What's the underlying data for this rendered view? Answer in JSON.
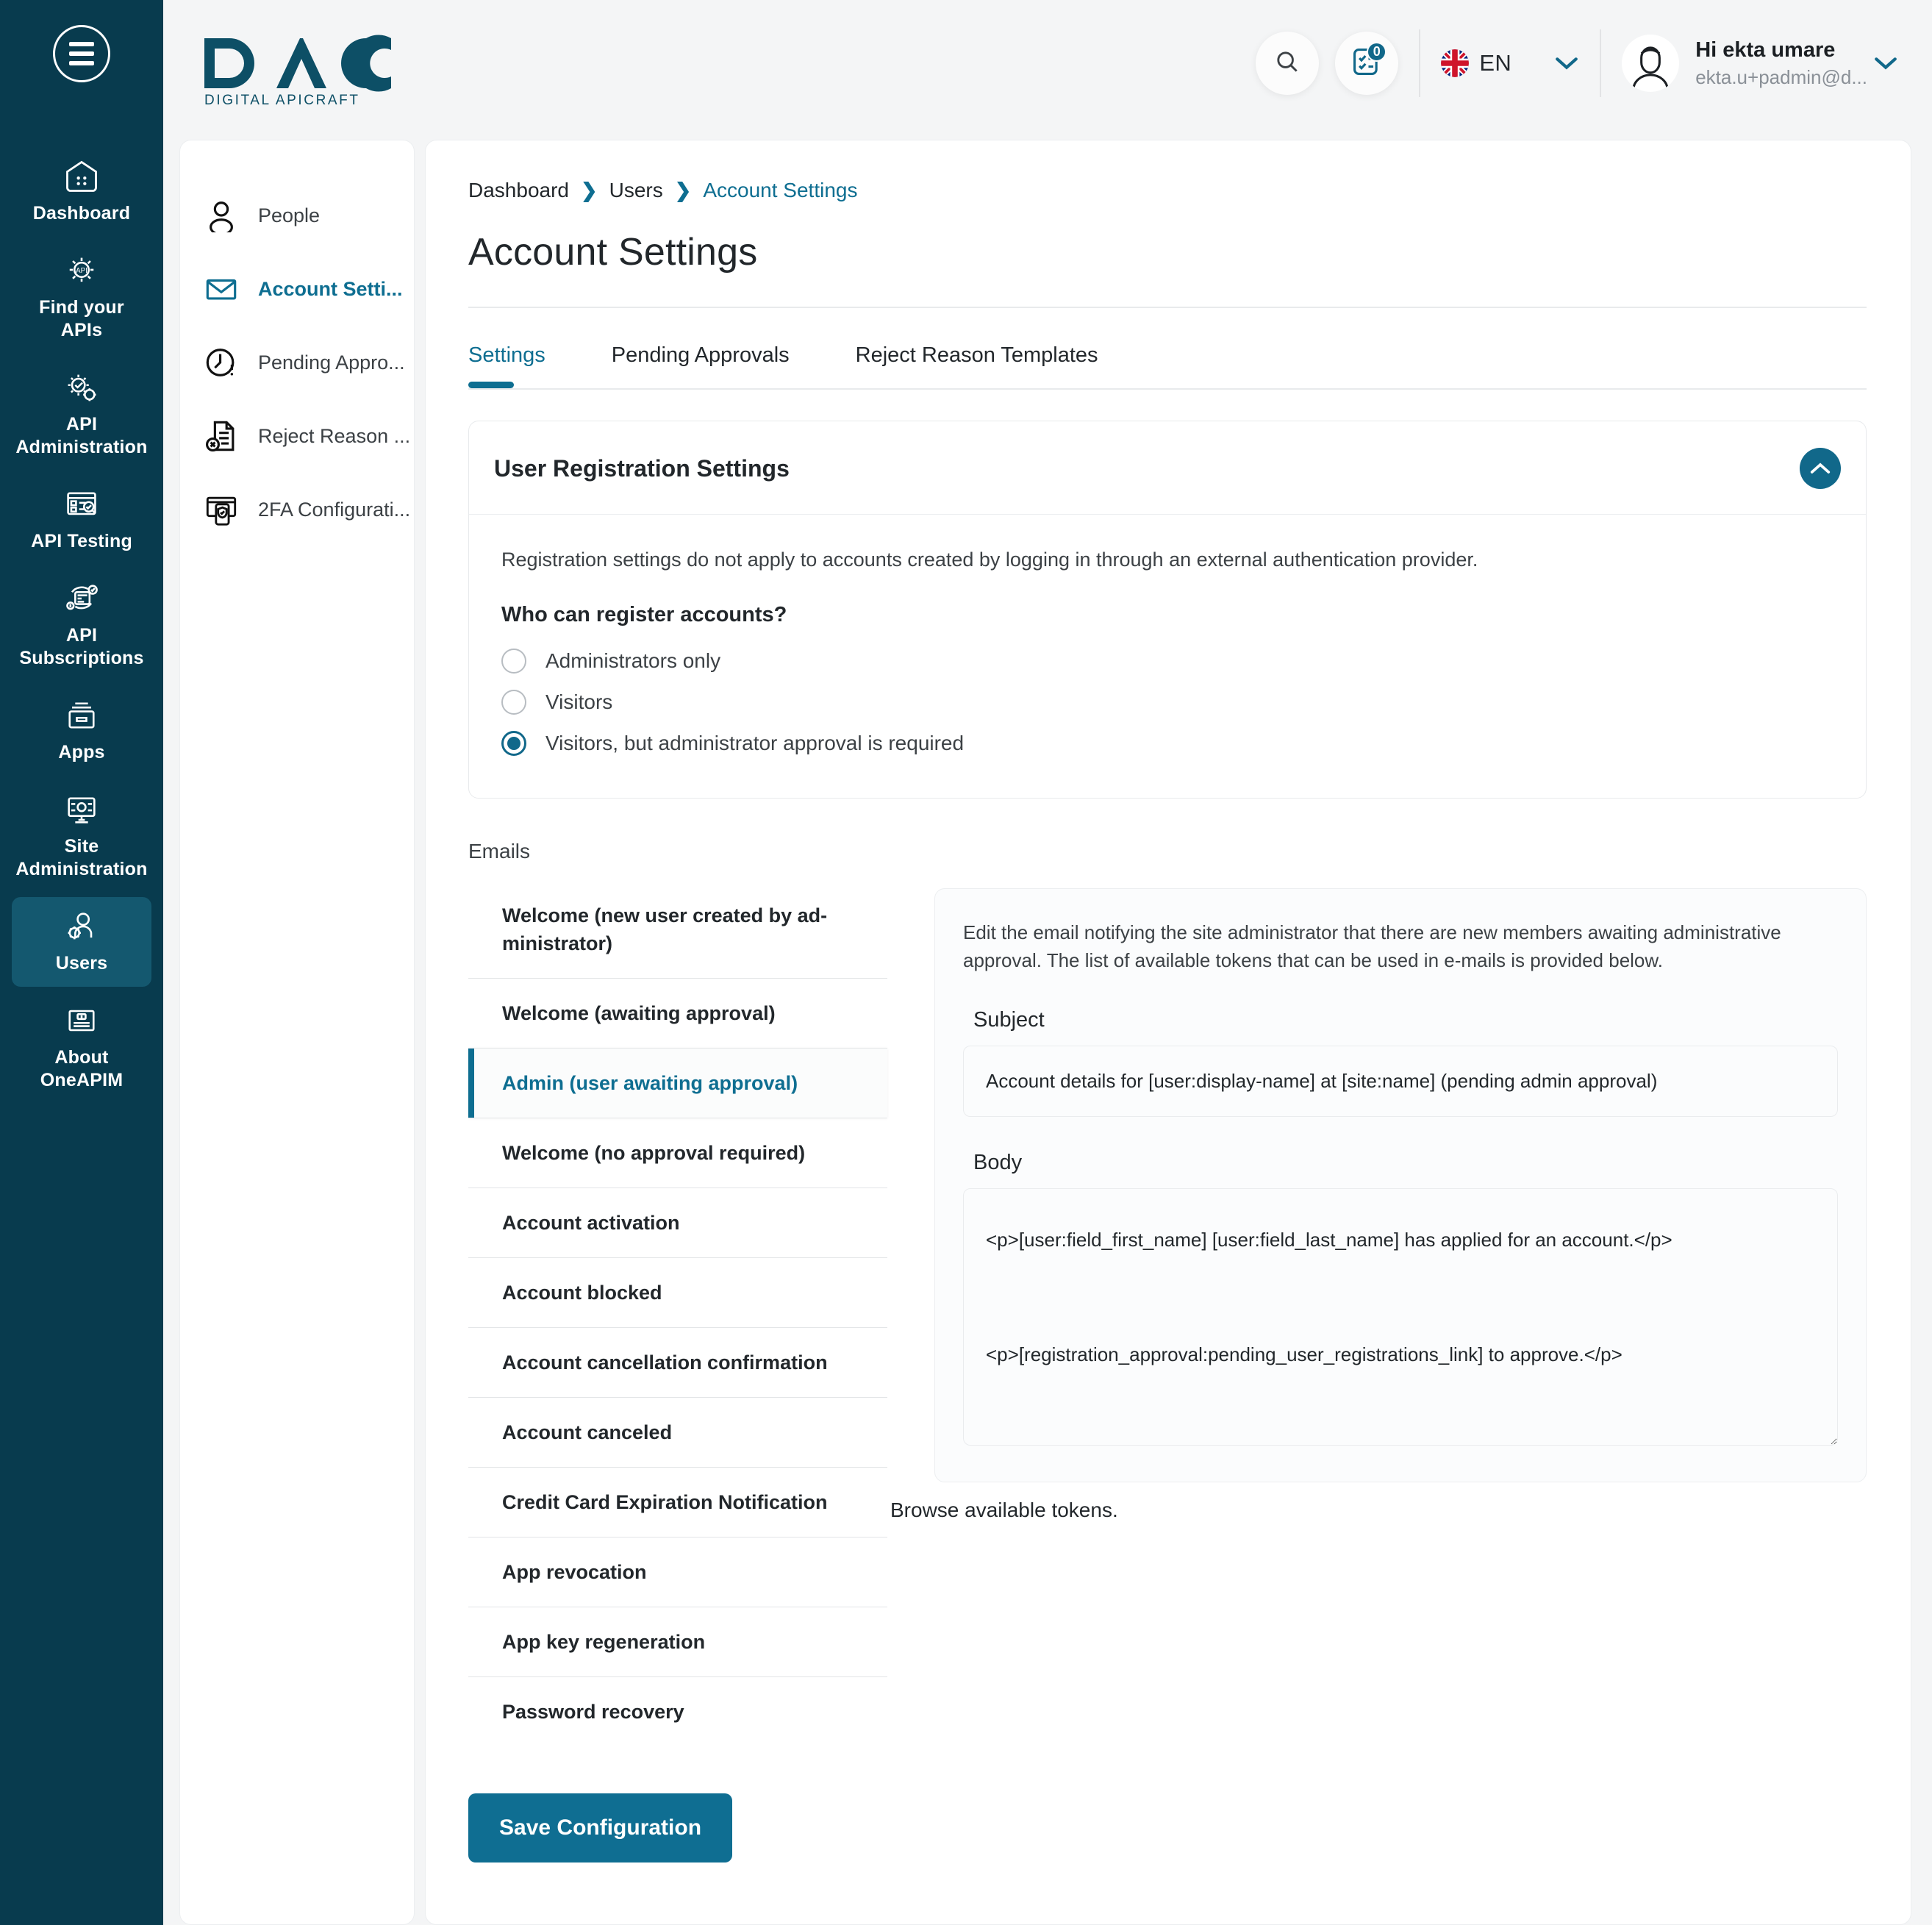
{
  "brand": {
    "logo_title": "DAC",
    "logo_subtitle": "DIGITAL APICRAFT",
    "accent": "#0e6e91",
    "rail_bg": "#083b4e",
    "rail_active_bg": "#14586f"
  },
  "rail": {
    "menu_icon": "hamburger-icon",
    "items": [
      {
        "label": "Dashboard",
        "icon": "dashboard-icon",
        "active": false
      },
      {
        "label": "Find your APIs",
        "icon": "find-apis-icon",
        "active": false
      },
      {
        "label": "API Administration",
        "icon": "api-administration-icon",
        "active": false
      },
      {
        "label": "API Testing",
        "icon": "api-testing-icon",
        "active": false
      },
      {
        "label": "API Subscriptions",
        "icon": "api-subscriptions-icon",
        "active": false
      },
      {
        "label": "Apps",
        "icon": "apps-icon",
        "active": false
      },
      {
        "label": "Site Administration",
        "icon": "site-administration-icon",
        "active": false
      },
      {
        "label": "Users",
        "icon": "users-icon",
        "active": true
      },
      {
        "label": "About OneAPIM",
        "icon": "about-icon",
        "active": false
      }
    ]
  },
  "header": {
    "search_icon": "search-icon",
    "notifications_icon": "checklist-icon",
    "notifications_count": "0",
    "language": {
      "code": "EN",
      "flag": "uk-flag-icon",
      "chevron": "chevron-down-icon"
    },
    "profile": {
      "greeting": "Hi ekta umare",
      "email": "ekta.u+padmin@d...",
      "avatar": "avatar-icon",
      "chevron": "chevron-down-icon"
    }
  },
  "subnav": {
    "items": [
      {
        "label": "People",
        "icon": "person-icon",
        "active": false
      },
      {
        "label": "Account Setti...",
        "icon": "envelope-icon",
        "active": true
      },
      {
        "label": "Pending Appro...",
        "icon": "clock-alert-icon",
        "active": false
      },
      {
        "label": "Reject Reason ...",
        "icon": "document-reject-icon",
        "active": false
      },
      {
        "label": "2FA Configurati...",
        "icon": "two-factor-icon",
        "active": false
      }
    ]
  },
  "breadcrumb": {
    "items": [
      "Dashboard",
      "Users",
      "Account Settings"
    ],
    "separator": "❯"
  },
  "page_title": "Account Settings",
  "tabs": [
    {
      "label": "Settings",
      "active": true
    },
    {
      "label": "Pending Approvals",
      "active": false
    },
    {
      "label": "Reject Reason Templates",
      "active": false
    }
  ],
  "registration_panel": {
    "title": "User Registration Settings",
    "collapse_icon": "chevron-up-icon",
    "note": "Registration settings do not apply to accounts created by logging in through an external authentication provider.",
    "question": "Who can register accounts?",
    "options": [
      {
        "label": "Administrators only",
        "selected": false
      },
      {
        "label": "Visitors",
        "selected": false
      },
      {
        "label": "Visitors, but administrator approval is required",
        "selected": true
      }
    ]
  },
  "emails": {
    "heading": "Emails",
    "items": [
      {
        "label": "Welcome (new user created by ad­ministrator)",
        "active": false
      },
      {
        "label": "Welcome (awaiting approval)",
        "active": false
      },
      {
        "label": "Admin (user awaiting approval)",
        "active": true
      },
      {
        "label": "Welcome (no approval required)",
        "active": false
      },
      {
        "label": "Account activation",
        "active": false
      },
      {
        "label": "Account blocked",
        "active": false
      },
      {
        "label": "Account cancellation confirmation",
        "active": false
      },
      {
        "label": "Account canceled",
        "active": false
      },
      {
        "label": "Credit Card Expiration Notification",
        "active": false
      },
      {
        "label": "App revocation",
        "active": false
      },
      {
        "label": "App key regeneration",
        "active": false
      },
      {
        "label": "Password recovery",
        "active": false
      }
    ],
    "editor": {
      "note": "Edit the email notifying the site administrator that there are new members awaiting administrative approval. The list of available tokens that can be used in e-mails is provided below.",
      "subject_label": "Subject",
      "subject_value": "Account details for [user:display-name] at [site:name] (pending admin approval)",
      "body_label": "Body",
      "body_value": "<p>[user:field_first_name] [user:field_last_name] has applied for an account.</p>\n\n<p>[registration_approval:pending_user_registrations_link] to approve.</p>"
    },
    "browse_tokens": "Browse available tokens.",
    "save_label": "Save Configuration"
  }
}
